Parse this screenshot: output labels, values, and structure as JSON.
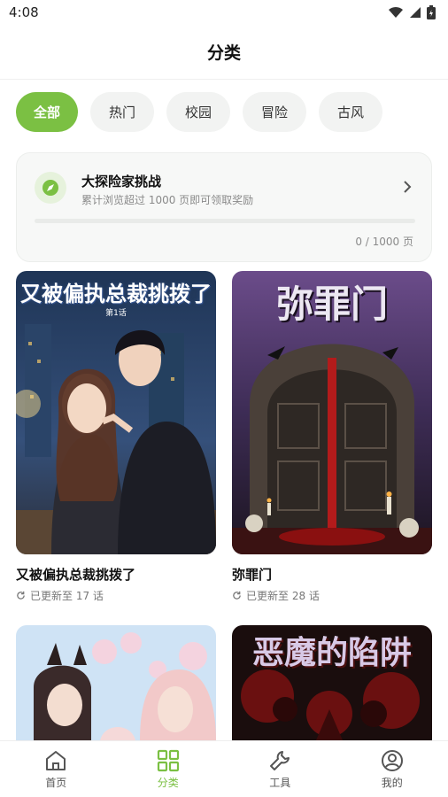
{
  "status_bar": {
    "time": "4:08"
  },
  "header": {
    "title": "分类"
  },
  "chips": [
    {
      "label": "全部",
      "active": true
    },
    {
      "label": "热门",
      "active": false
    },
    {
      "label": "校园",
      "active": false
    },
    {
      "label": "冒险",
      "active": false
    },
    {
      "label": "古风",
      "active": false
    }
  ],
  "challenge": {
    "title": "大探险家挑战",
    "description": "累计浏览超过 1000 页即可领取奖励",
    "progress_text": "0 / 1000 页",
    "progress_value": 0,
    "progress_max": 1000
  },
  "comics": [
    {
      "cover_title": "又被偏执总裁挑拨了",
      "cover_subtitle": "第1话",
      "name": "又被偏执总裁挑拨了",
      "update": "已更新至 17 话"
    },
    {
      "cover_title": "弥罪门",
      "name": "弥罪门",
      "update": "已更新至 28 话"
    },
    {
      "cover_title": ""
    },
    {
      "cover_title": "恶魔的陷阱"
    }
  ],
  "nav": [
    {
      "label": "首页",
      "icon": "home-icon",
      "active": false
    },
    {
      "label": "分类",
      "icon": "grid-icon",
      "active": true
    },
    {
      "label": "工具",
      "icon": "wrench-icon",
      "active": false
    },
    {
      "label": "我的",
      "icon": "profile-icon",
      "active": false
    }
  ],
  "colors": {
    "accent": "#7bc043",
    "chip_bg": "#f2f3f2",
    "muted_text": "#8a8a8a"
  }
}
